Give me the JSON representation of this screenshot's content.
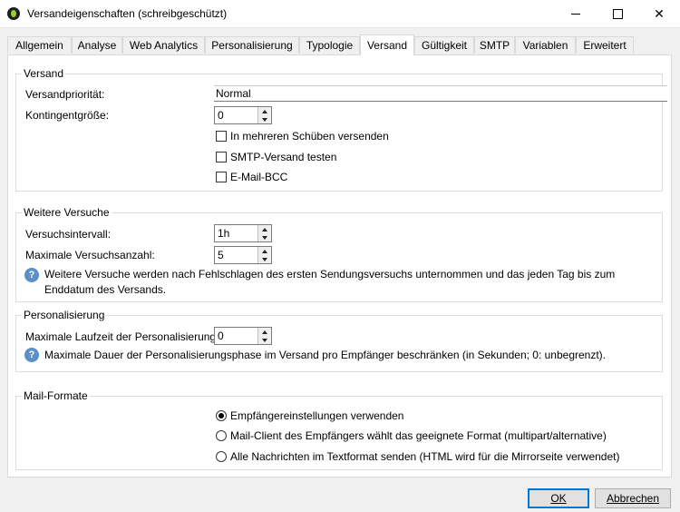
{
  "window": {
    "title": "Versandeigenschaften (schreibgeschützt)",
    "controls": {
      "minimize": "—",
      "maximize": "☐",
      "close": "✕"
    }
  },
  "tabs": [
    {
      "label": "Allgemein"
    },
    {
      "label": "Analyse"
    },
    {
      "label": "Web Analytics"
    },
    {
      "label": "Personalisierung"
    },
    {
      "label": "Typologie"
    },
    {
      "label": "Versand",
      "active": true
    },
    {
      "label": "Gültigkeit"
    },
    {
      "label": "SMTP"
    },
    {
      "label": "Variablen"
    },
    {
      "label": "Erweitert"
    }
  ],
  "versand": {
    "title": "Versand",
    "priority_label": "Versandpriorität:",
    "priority_value": "Normal",
    "quota_label": "Kontingentgröße:",
    "quota_value": "0",
    "checkboxes": [
      {
        "label": "In mehreren Schüben versenden",
        "checked": false
      },
      {
        "label": "SMTP-Versand testen",
        "checked": false
      },
      {
        "label": "E-Mail-BCC",
        "checked": false
      }
    ]
  },
  "retries": {
    "title": "Weitere Versuche",
    "interval_label": "Versuchsintervall:",
    "interval_value": "1h",
    "max_label": "Maximale Versuchsanzahl:",
    "max_value": "5",
    "info_line1": "Weitere Versuche werden nach Fehlschlagen des ersten Sendungsversuchs unternommen und das jeden Tag bis zum",
    "info_line2": "Enddatum des Versands."
  },
  "personalization": {
    "title": "Personalisierung",
    "duration_label": "Maximale Laufzeit der Personalisierung:",
    "duration_value": "0",
    "info": "Maximale Dauer der Personalisierungsphase im Versand pro Empfänger beschränken (in Sekunden; 0: unbegrenzt)."
  },
  "mail_formats": {
    "title": "Mail-Formate",
    "options": [
      {
        "label": "Empfängereinstellungen verwenden",
        "selected": true
      },
      {
        "label": "Mail-Client des Empfängers wählt das geeignete Format (multipart/alternative)",
        "selected": false
      },
      {
        "label": "Alle Nachrichten im Textformat senden (HTML wird für die Mirrorseite verwendet)",
        "selected": false
      }
    ]
  },
  "footer": {
    "ok_label": "OK",
    "cancel_label": "Abbrechen"
  },
  "colors": {
    "default_button_border": "#0078d7",
    "info_icon": "#5b8fc9"
  }
}
